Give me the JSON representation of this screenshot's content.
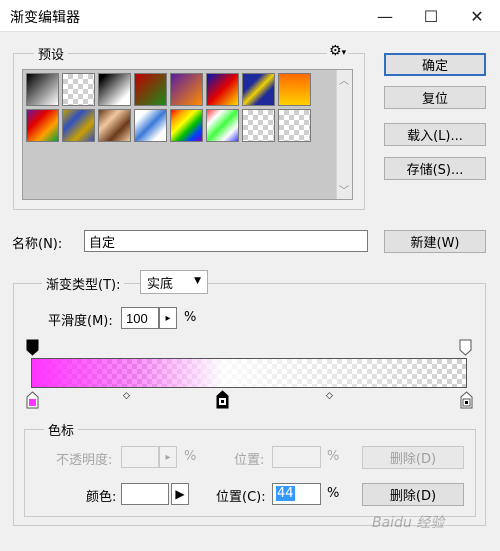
{
  "window": {
    "title": "渐变编辑器",
    "minimize": "—",
    "maximize": "☐",
    "close": "✕"
  },
  "presets": {
    "label": "预设",
    "menu_glyph": "⚙",
    "scroll_up": "︿",
    "scroll_down": "﹀"
  },
  "buttons": {
    "ok": "确定",
    "reset": "复位",
    "load": "载入(L)...",
    "save": "存储(S)...",
    "new": "新建(W)"
  },
  "name": {
    "label": "名称(N):",
    "value": "自定"
  },
  "gradient": {
    "type_label": "渐变类型(T):",
    "type_value": "实底",
    "smooth_label": "平滑度(M):",
    "smooth_value": "100",
    "smooth_unit": "%",
    "arrow_glyph": "▸"
  },
  "stops": {
    "group_label": "色标",
    "opacity_label": "不透明度:",
    "opacity_unit": "%",
    "opacity_location_label": "位置:",
    "opacity_location_unit": "%",
    "delete_disabled": "删除(D)",
    "color_label": "颜色:",
    "color_location_label": "位置(C):",
    "color_location_value": "44",
    "color_location_unit": "%",
    "delete": "删除(D)",
    "color_value": "#ffffff",
    "start_color": "#ff33ff"
  },
  "watermark": "Baidu 经验"
}
